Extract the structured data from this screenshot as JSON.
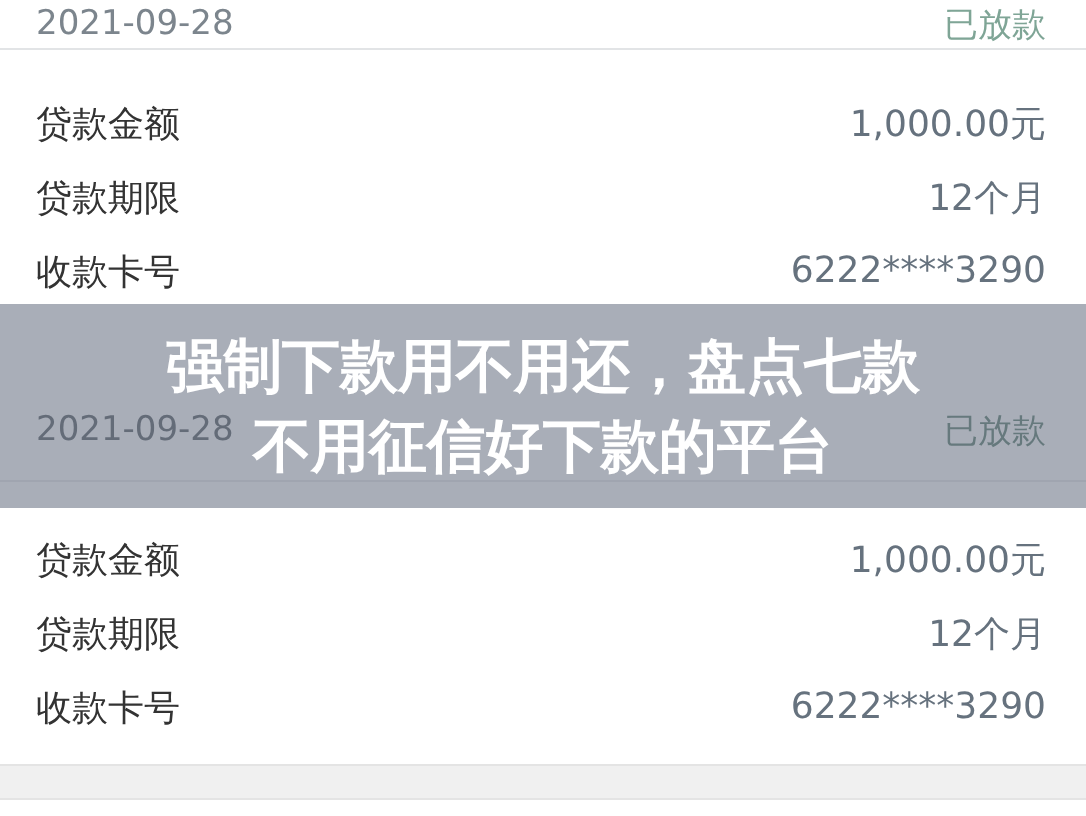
{
  "records": [
    {
      "date": "2021-09-28",
      "status": "已放款",
      "details": [
        {
          "label": "贷款金额",
          "value": "1,000.00元"
        },
        {
          "label": "贷款期限",
          "value": "12个月"
        },
        {
          "label": "收款卡号",
          "value": "6222****3290"
        }
      ]
    },
    {
      "date": "2021-09-28",
      "status": "已放款",
      "details": [
        {
          "label": "贷款金额",
          "value": "1,000.00元"
        },
        {
          "label": "贷款期限",
          "value": "12个月"
        },
        {
          "label": "收款卡号",
          "value": "6222****3290"
        }
      ]
    }
  ],
  "banner": {
    "lines": [
      "强制下款用不用还，盘点七款",
      "不用征信好下款的平台"
    ]
  }
}
